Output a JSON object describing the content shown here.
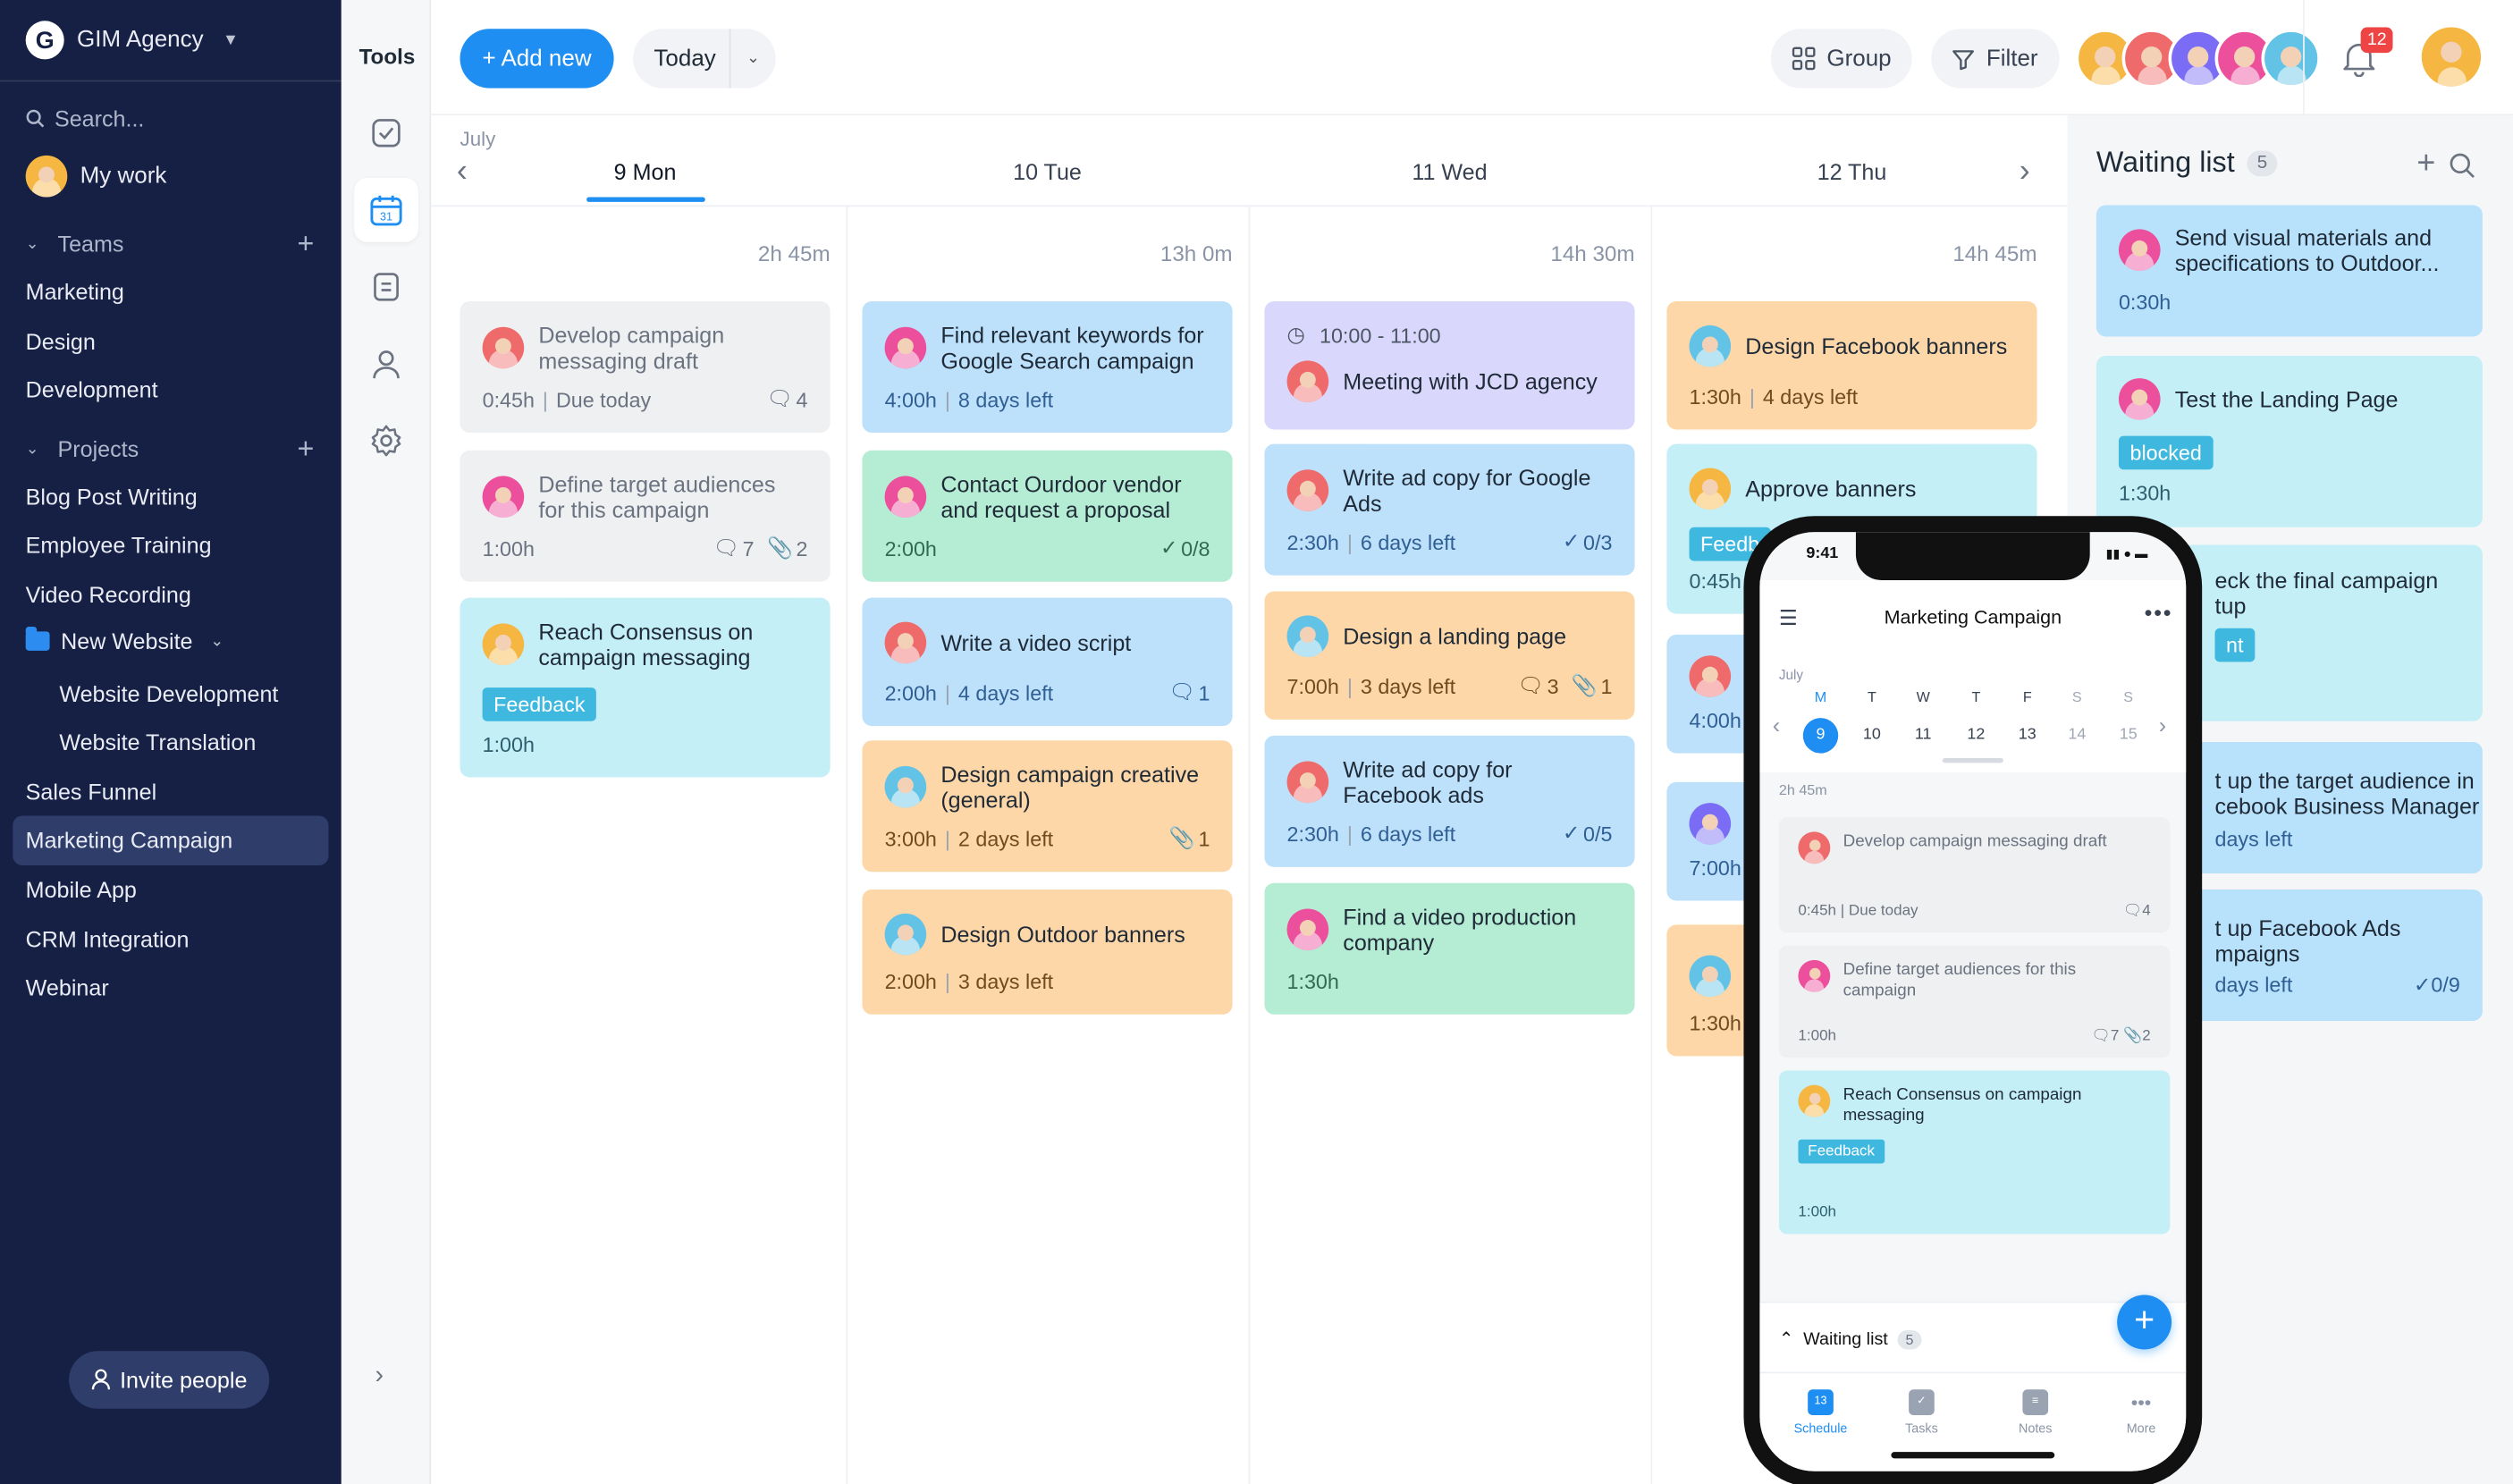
{
  "workspace": {
    "name": "GIM Agency",
    "logo_letter": "G"
  },
  "sidebar": {
    "search_placeholder": "Search...",
    "my_work": "My work",
    "teams_label": "Teams",
    "teams": [
      "Marketing",
      "Design",
      "Development"
    ],
    "projects_label": "Projects",
    "projects": [
      "Blog Post Writing",
      "Employee Training",
      "Video Recording"
    ],
    "folder": {
      "label": "New Website",
      "children": [
        "Website Development",
        "Website Translation"
      ]
    },
    "projects_more": [
      "Sales Funnel",
      "Marketing Campaign",
      "Mobile App",
      "CRM Integration",
      "Webinar"
    ],
    "active_project": "Marketing Campaign",
    "invite_label": "Invite people"
  },
  "tools": {
    "title": "Tools",
    "active": "calendar",
    "calendar_day": "31"
  },
  "topbar": {
    "add_label": "+ Add new",
    "today_label": "Today",
    "group_label": "Group",
    "filter_label": "Filter",
    "notification_count": "12"
  },
  "calendar": {
    "month": "July",
    "days": [
      {
        "label": "9 Mon",
        "total": "2h 45m",
        "active": true
      },
      {
        "label": "10 Tue",
        "total": "13h 0m"
      },
      {
        "label": "11 Wed",
        "total": "14h 30m"
      },
      {
        "label": "12 Thu",
        "total": "14h 45m"
      }
    ],
    "columns": [
      [
        {
          "title": "Develop campaign messaging draft",
          "duration": "0:45h",
          "due": "Due today",
          "comments": "4",
          "color": "gray",
          "done": true
        },
        {
          "title": "Define target audiences for this campaign",
          "duration": "1:00h",
          "comments": "7",
          "attachments": "2",
          "color": "gray",
          "done": true
        },
        {
          "title": "Reach Consensus on campaign messaging",
          "tag": "Feedback",
          "duration": "1:00h",
          "color": "cyan"
        }
      ],
      [
        {
          "title": "Find relevant keywords for Google Search campaign",
          "duration": "4:00h",
          "due": "8 days left",
          "color": "blue"
        },
        {
          "title": "Contact Ourdoor vendor and request a proposal",
          "duration": "2:00h",
          "checklist": "0/8",
          "color": "green"
        },
        {
          "title": "Write a video script",
          "duration": "2:00h",
          "due": "4 days left",
          "comments": "1",
          "color": "blue"
        },
        {
          "title": "Design campaign creative (general)",
          "duration": "3:00h",
          "due": "2 days left",
          "attachments": "1",
          "color": "orange"
        },
        {
          "title": "Design Outdoor banners",
          "duration": "2:00h",
          "due": "3 days left",
          "color": "orange"
        }
      ],
      [
        {
          "time": "10:00 - 11:00",
          "title": "Meeting with JCD agency",
          "color": "purple"
        },
        {
          "title": "Write ad copy for Google Ads",
          "duration": "2:30h",
          "due": "6 days left",
          "checklist": "0/3",
          "color": "blue"
        },
        {
          "title": "Design a landing page",
          "duration": "7:00h",
          "due": "3 days left",
          "comments": "3",
          "attachments": "1",
          "color": "orange"
        },
        {
          "title": "Write ad copy for Facebook ads",
          "duration": "2:30h",
          "due": "6 days left",
          "checklist": "0/5",
          "color": "blue"
        },
        {
          "title": "Find a video production company",
          "duration": "1:30h",
          "color": "green"
        }
      ],
      [
        {
          "title": "Design Facebook banners",
          "duration": "1:30h",
          "due": "4 days left",
          "color": "orange"
        },
        {
          "title": "Approve banners",
          "tag": "Feedb",
          "duration": "0:45h",
          "color": "cyan"
        },
        {
          "duration": "4:00h",
          "color": "blue"
        },
        {
          "duration": "7:00h",
          "color": "blue"
        },
        {
          "duration": "1:30h",
          "color": "orange"
        }
      ]
    ]
  },
  "waiting_list": {
    "title": "Waiting list",
    "count": "5",
    "items": [
      {
        "title": "Send visual materials and specifications to Outdoor...",
        "duration": "0:30h"
      },
      {
        "title": "Test the Landing Page",
        "tag": "blocked",
        "duration": "1:30h"
      },
      {
        "title": "eck the final campaign tup",
        "tag": "nt"
      },
      {
        "title": "t up the target audience in cebook Business Manager",
        "due": "days left"
      },
      {
        "title": "t up Facebook Ads mpaigns",
        "due": "days left",
        "checklist": "0/9"
      }
    ]
  },
  "phone": {
    "time": "9:41",
    "title": "Marketing Campaign",
    "month": "July",
    "week": [
      {
        "l": "M",
        "n": "9",
        "active": true
      },
      {
        "l": "T",
        "n": "10"
      },
      {
        "l": "W",
        "n": "11"
      },
      {
        "l": "T",
        "n": "12"
      },
      {
        "l": "F",
        "n": "13"
      },
      {
        "l": "S",
        "n": "14",
        "weekend": true
      },
      {
        "l": "S",
        "n": "15",
        "weekend": true
      }
    ],
    "total": "2h 45m",
    "cards": [
      {
        "title": "Develop campaign messaging draft",
        "duration": "0:45h",
        "due": "Due today",
        "comments": "4"
      },
      {
        "title": "Define target audiences for this campaign",
        "duration": "1:00h",
        "comments": "7",
        "attachments": "2"
      },
      {
        "title": "Reach Consensus on campaign messaging",
        "tag": "Feedback",
        "duration": "1:00h"
      }
    ],
    "waiting_label": "Waiting list",
    "waiting_count": "5",
    "tabs": [
      "Schedule",
      "Tasks",
      "Notes",
      "More"
    ],
    "active_tab": "Schedule",
    "schedule_icon_day": "13"
  },
  "colors": {
    "sidebar_bg": "#162044",
    "accent": "#1e8ef2",
    "card_gray": "#eef0f2",
    "card_blue": "#bde0fb",
    "card_cyan": "#c4eff7",
    "card_green": "#b5ecd4",
    "card_orange": "#fdd7a8",
    "card_purple": "#d9d7fb",
    "tag_feedback": "#3fb8e0",
    "notification": "#ef4444"
  }
}
